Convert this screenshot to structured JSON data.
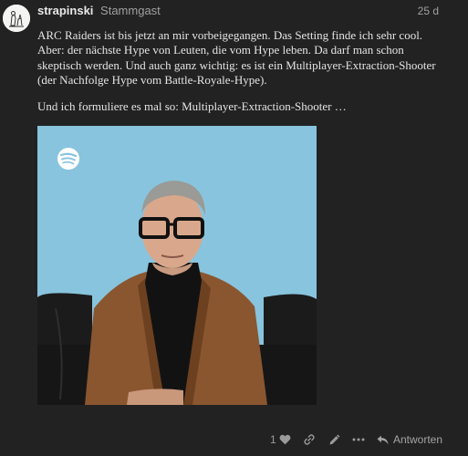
{
  "post": {
    "username": "strapinski",
    "user_title": "Stammgast",
    "age": "25 d",
    "paragraphs": [
      "ARC Raiders ist bis jetzt an mir vorbeigegangen. Das Setting finde ich sehr cool. Aber: der nächste Hype von Leuten, die vom Hype leben. Da darf man schon skeptisch werden. Und auch ganz wichtig: es ist ein Multiplayer-Extraction-Shooter (der Nachfolge Hype vom Battle-Royale-Hype).",
      "Und ich formuliere es mal so: Multiplayer-Extraction-Shooter …"
    ],
    "media": {
      "icon": "spotify-icon"
    }
  },
  "actions": {
    "like_count": "1",
    "like_icon": "heart-icon",
    "link_icon": "link-icon",
    "edit_icon": "pencil-icon",
    "more_icon": "ellipsis-icon",
    "reply_label": "Antworten",
    "reply_icon": "reply-arrow-icon"
  },
  "colors": {
    "background": "#222222",
    "text": "#e4e4e4",
    "muted": "#a0a0a0",
    "image_backdrop": "#88c4dd"
  }
}
